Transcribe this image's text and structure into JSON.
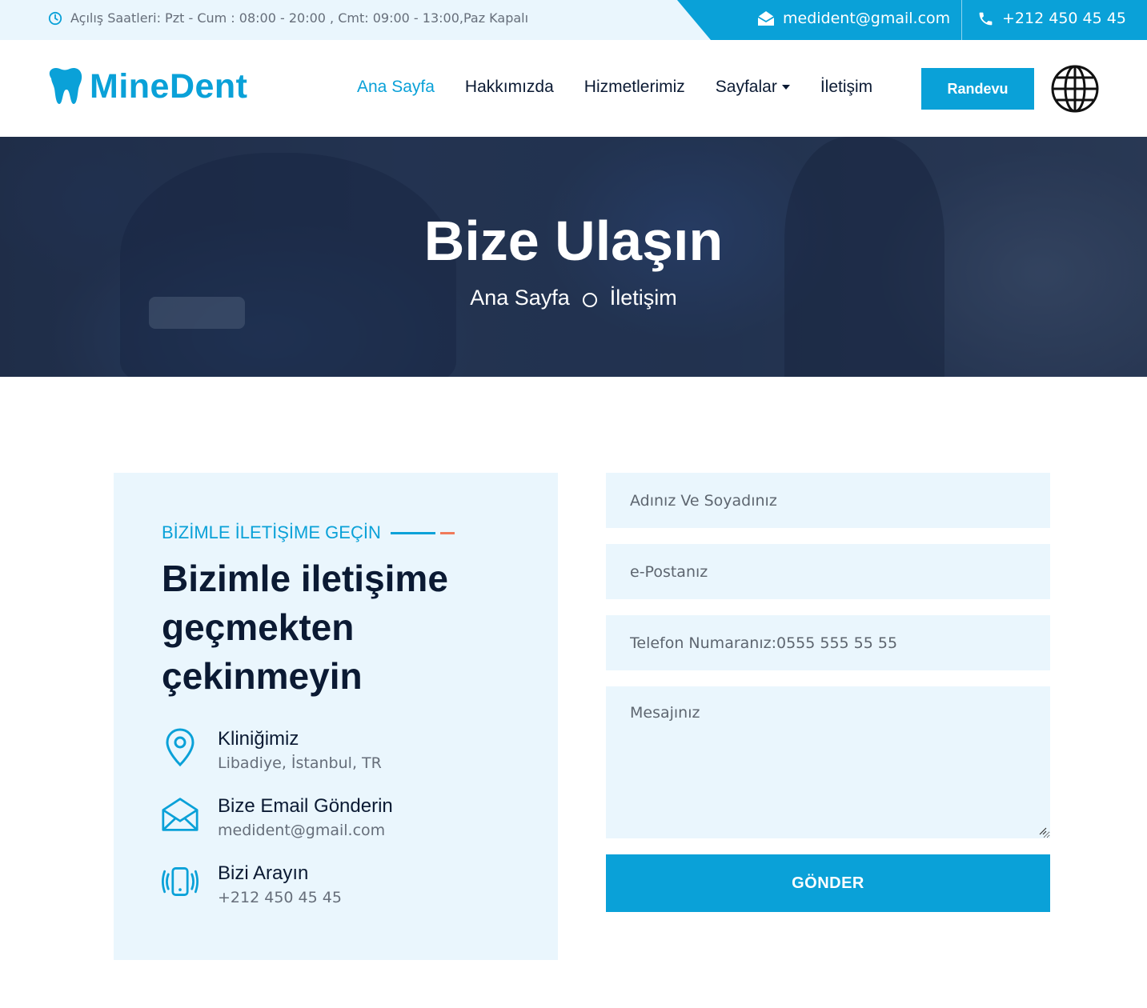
{
  "topbar": {
    "hours": "Açılış Saatleri: Pzt - Cum : 08:00 - 20:00 , Cmt: 09:00 - 13:00,Paz Kapalı",
    "email": "medident@gmail.com",
    "phone": "+212 450 45 45"
  },
  "header": {
    "logo": "MineDent",
    "menu": [
      "Ana Sayfa",
      "Hakkımızda",
      "Hizmetlerimiz",
      "Sayfalar",
      "İletişim"
    ],
    "cta": "Randevu"
  },
  "hero": {
    "title": "Bize Ulaşın",
    "breadcrumb": [
      "Ana Sayfa",
      "İletişim"
    ]
  },
  "contact": {
    "eyebrow": "BİZİMLE İLETİŞİME GEÇİN",
    "heading": "Bizimle iletişime geçmekten çekinmeyin",
    "items": [
      {
        "title": "Kliniğimiz",
        "sub": "Libadiye, İstanbul, TR",
        "icon": "map-pin-icon"
      },
      {
        "title": "Bize Email Gönderin",
        "sub": "medident@gmail.com",
        "icon": "envelope-icon"
      },
      {
        "title": "Bizi Arayın",
        "sub": "+212 450 45 45",
        "icon": "phone-ring-icon"
      }
    ]
  },
  "form": {
    "name_placeholder": "Adınız Ve Soyadınız",
    "email_placeholder": "e-Postanız",
    "phone_placeholder": "Telefon Numaranız:0555 555 55 55",
    "message_placeholder": "Mesajınız",
    "submit": "GÖNDER"
  },
  "colors": {
    "accent": "#0aa1d8",
    "dark": "#0b1a33",
    "light_bg": "#eaf6fd",
    "secondary_accent": "#f07a5a"
  }
}
